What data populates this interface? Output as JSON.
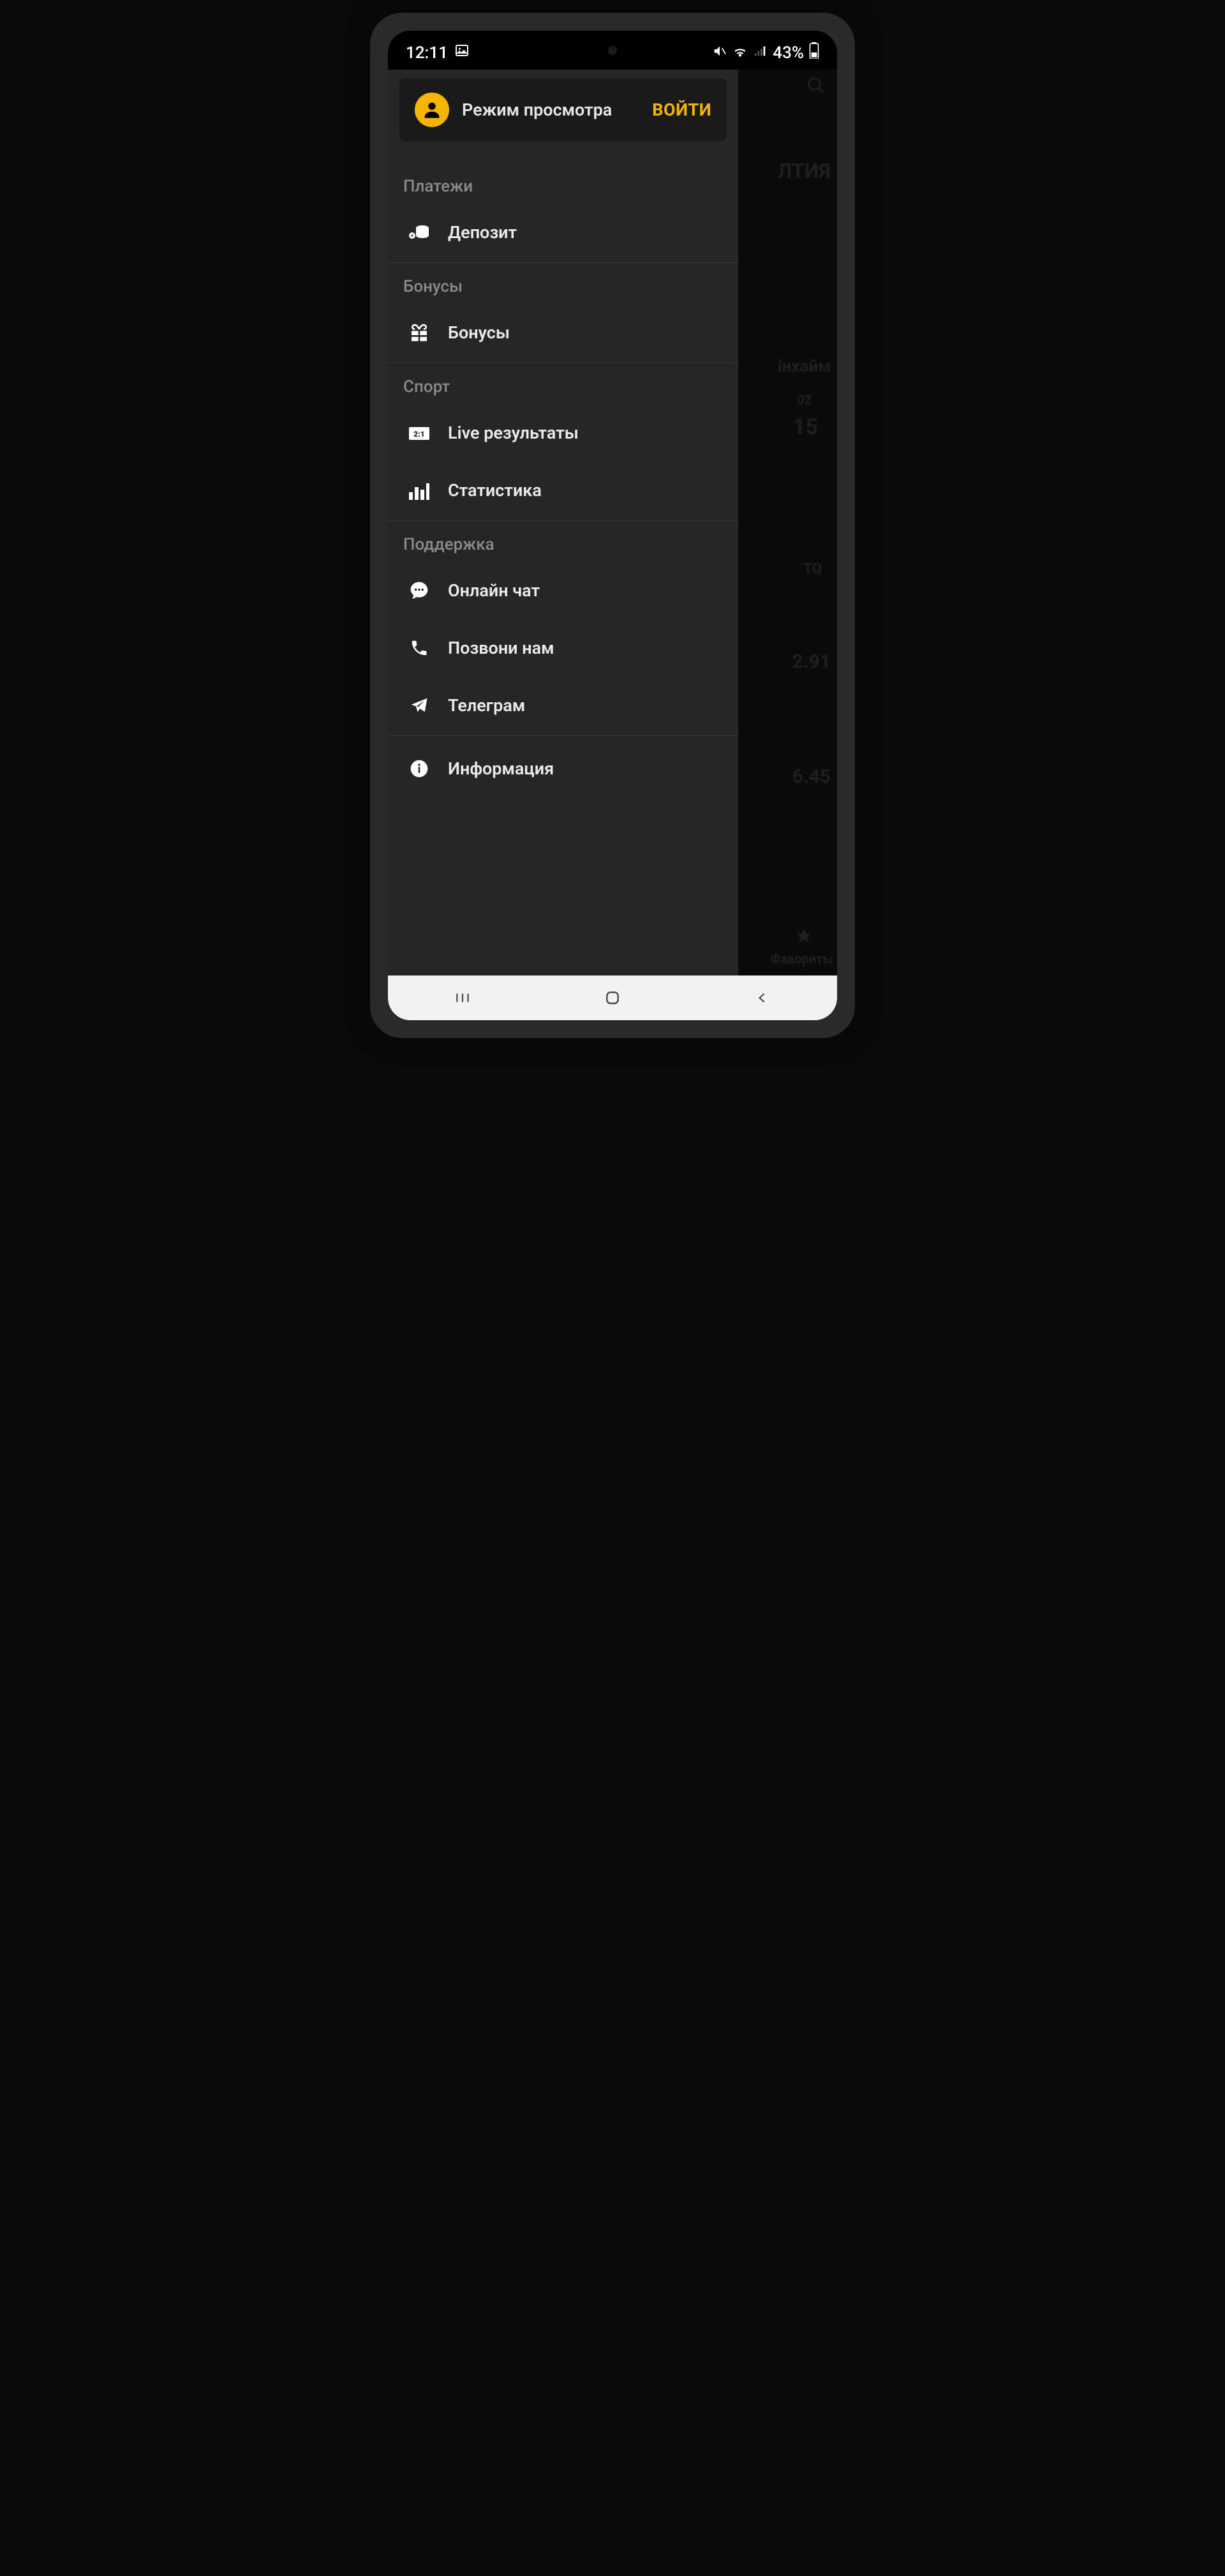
{
  "status": {
    "time": "12:11",
    "battery": "43%"
  },
  "header": {
    "title": "Режим просмотра",
    "login": "ВОЙТИ"
  },
  "sections": {
    "payments": {
      "label": "Платежи",
      "deposit": "Депозит"
    },
    "bonuses": {
      "label": "Бонусы",
      "bonuses": "Бонусы"
    },
    "sport": {
      "label": "Спорт",
      "live": "Live результаты",
      "stats": "Статистика"
    },
    "support": {
      "label": "Поддержка",
      "chat": "Онлайн чат",
      "call": "Позвони нам",
      "telegram": "Телеграм"
    },
    "info": {
      "information": "Информация"
    }
  },
  "backdrop": {
    "t1": "ЛТИЯ",
    "t2": "інхайм",
    "t3": "02",
    "t4": "15",
    "t5": "ТО",
    "t6": "2.91",
    "t7": "6.45",
    "t8": "Фавориты"
  }
}
